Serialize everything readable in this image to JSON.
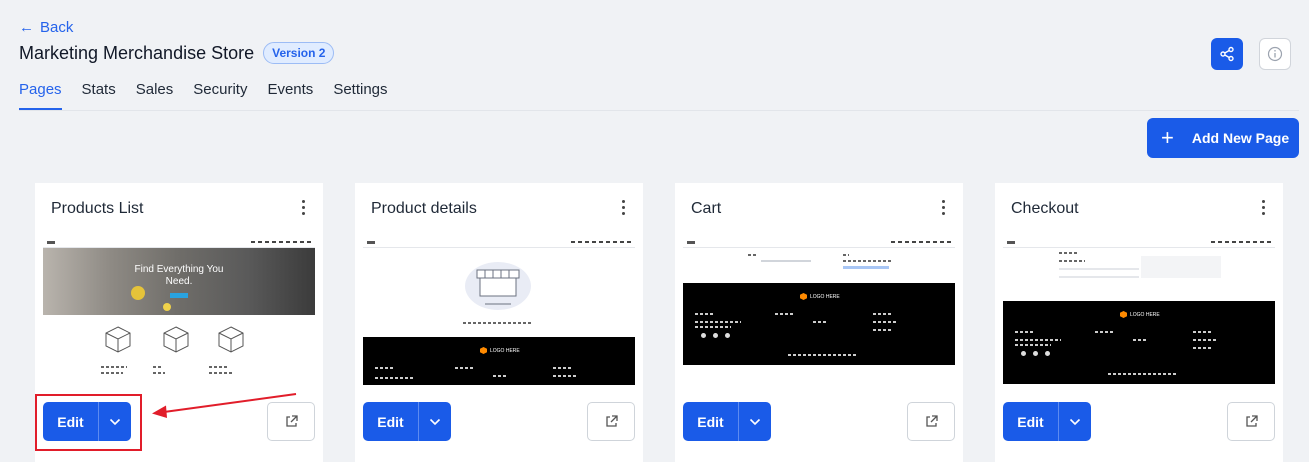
{
  "header": {
    "back_label": "Back",
    "title": "Marketing Merchandise Store",
    "version_badge": "Version 2"
  },
  "tabs": [
    {
      "label": "Pages",
      "active": true
    },
    {
      "label": "Stats"
    },
    {
      "label": "Sales"
    },
    {
      "label": "Security"
    },
    {
      "label": "Events"
    },
    {
      "label": "Settings"
    }
  ],
  "actions": {
    "add_page_label": "Add New Page",
    "share_icon": "share-icon",
    "info_icon": "info-icon"
  },
  "cards": [
    {
      "title": "Products List",
      "preview": "products-list",
      "hero_text": "Find Everything You Need.",
      "edit_label": "Edit"
    },
    {
      "title": "Product details",
      "preview": "empty-store",
      "logo_text": "LOGO HERE",
      "edit_label": "Edit"
    },
    {
      "title": "Cart",
      "preview": "cart",
      "logo_text": "LOGO HERE",
      "edit_label": "Edit"
    },
    {
      "title": "Checkout",
      "preview": "checkout",
      "logo_text": "LOGO HERE",
      "edit_label": "Edit"
    }
  ],
  "colors": {
    "accent": "#1a5be8",
    "highlight": "#e11d2a"
  }
}
